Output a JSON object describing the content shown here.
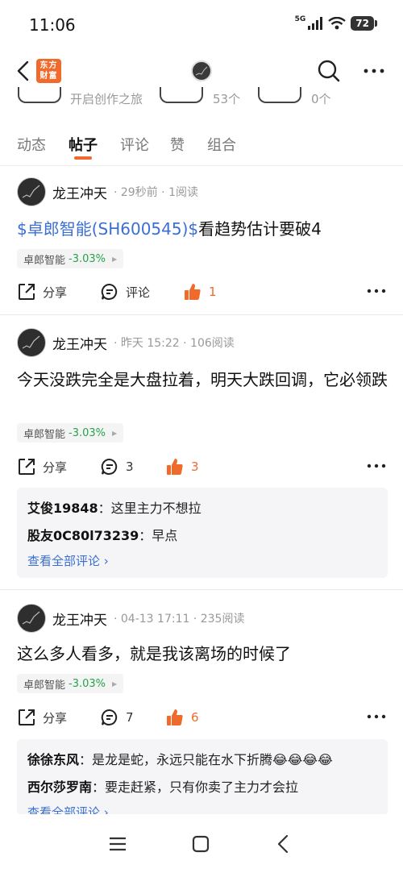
{
  "status_bar": {
    "time": "11:06",
    "network": "5G",
    "battery": "72"
  },
  "header": {
    "logo_text": "东方\n财富"
  },
  "stats_strip": {
    "items": [
      "开启创作之旅",
      "53个",
      "0个"
    ]
  },
  "tabs": [
    "动态",
    "帖子",
    "评论",
    "赞",
    "组合"
  ],
  "active_tab": 1,
  "posts": [
    {
      "author": "龙王冲天",
      "meta": "· 29秒前 · 1阅读",
      "ticker": "$卓郎智能(SH600545)$",
      "text": "看趋势估计要破4",
      "stock": {
        "name": "卓郎智能",
        "change": "-3.03%"
      },
      "share": "分享",
      "comment": "评论",
      "likes": "1"
    },
    {
      "author": "龙王冲天",
      "meta": "· 昨天 15:22 · 106阅读",
      "text": "今天没跌完全是大盘拉着，明天大跌回调，它必领跌",
      "stock": {
        "name": "卓郎智能",
        "change": "-3.03%"
      },
      "share": "分享",
      "comment": "3",
      "likes": "3",
      "comments": [
        {
          "name": "艾俊19848",
          "text": "：这里主力不想拉"
        },
        {
          "name": "股友0C80l73239",
          "text": "：早点"
        }
      ],
      "view_all": "查看全部评论 ›"
    },
    {
      "author": "龙王冲天",
      "meta": "· 04-13 17:11 · 235阅读",
      "text": "这么多人看多，就是我该离场的时候了",
      "stock": {
        "name": "卓郎智能",
        "change": "-3.03%"
      },
      "share": "分享",
      "comment": "7",
      "likes": "6",
      "comments": [
        {
          "name": "徐徐东风",
          "text": "：是龙是蛇，永远只能在水下折腾😂😂😂😂"
        },
        {
          "name": "西尔莎罗南",
          "text": "：要走赶紧，只有你卖了主力才会拉"
        }
      ],
      "view_all": "查看全部评论 ›"
    }
  ],
  "colors": {
    "accent": "#f06a2c",
    "link": "#3b6fd4",
    "down": "#25a34a"
  }
}
